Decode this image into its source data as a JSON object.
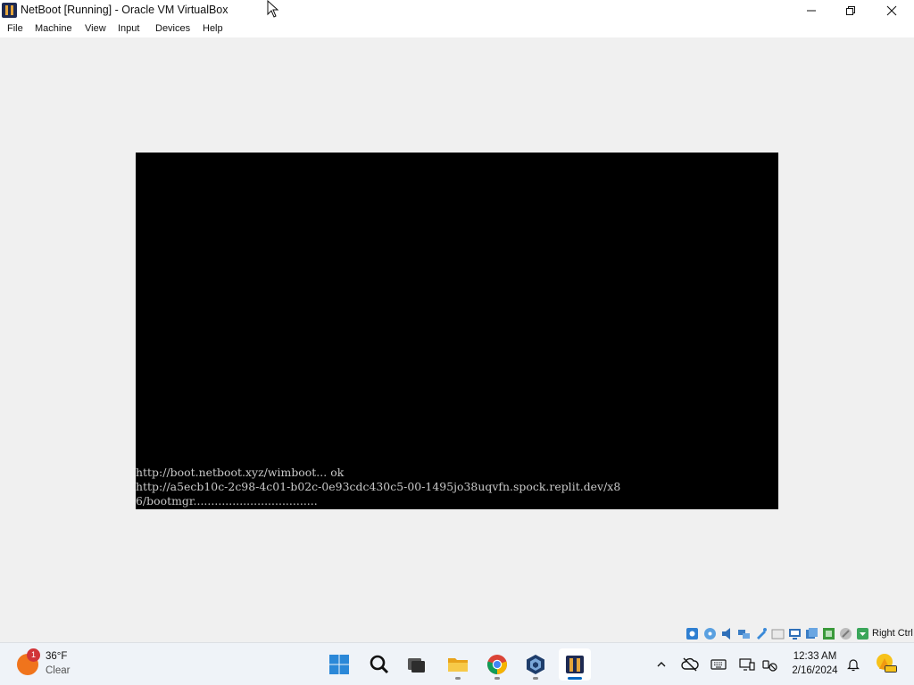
{
  "window": {
    "title": "NetBoot [Running] - Oracle VM VirtualBox",
    "buttons": [
      "minimize",
      "maximize",
      "close"
    ]
  },
  "menu": {
    "items": [
      "File",
      "Machine",
      "View",
      "Input",
      "Devices",
      "Help"
    ]
  },
  "console": {
    "lines": [
      "http://boot.netboot.xyz/wimboot... ok",
      "http://a5ecb10c-2c98-4c01-b02c-0e93cdc430c5-00-1495jo38uqvfn.spock.replit.dev/x8",
      "6/bootmgr..................................."
    ]
  },
  "statusbar": {
    "icons": [
      "hard-disk-icon",
      "optical-drive-icon",
      "audio-icon",
      "network-icon",
      "usb-icon",
      "shared-folders-icon",
      "display-icon",
      "recording-icon",
      "cpu-icon",
      "mouse-integration-icon",
      "host-key-icon"
    ],
    "host_key": "Right Ctrl"
  },
  "taskbar": {
    "weather": {
      "badge": "1",
      "temp": "36°F",
      "condition": "Clear"
    },
    "apps": [
      "start-button",
      "search-button",
      "task-view-button",
      "file-explorer-button",
      "chrome-button",
      "virtualbox-button",
      "netboot-vm-button"
    ],
    "clock": {
      "time": "12:33 AM",
      "date": "2/16/2024"
    }
  },
  "colors": {
    "accent": "#0067c0",
    "vm_background": "#000000",
    "console_text": "#c9c9c9",
    "window_background": "#f0f0f0"
  }
}
